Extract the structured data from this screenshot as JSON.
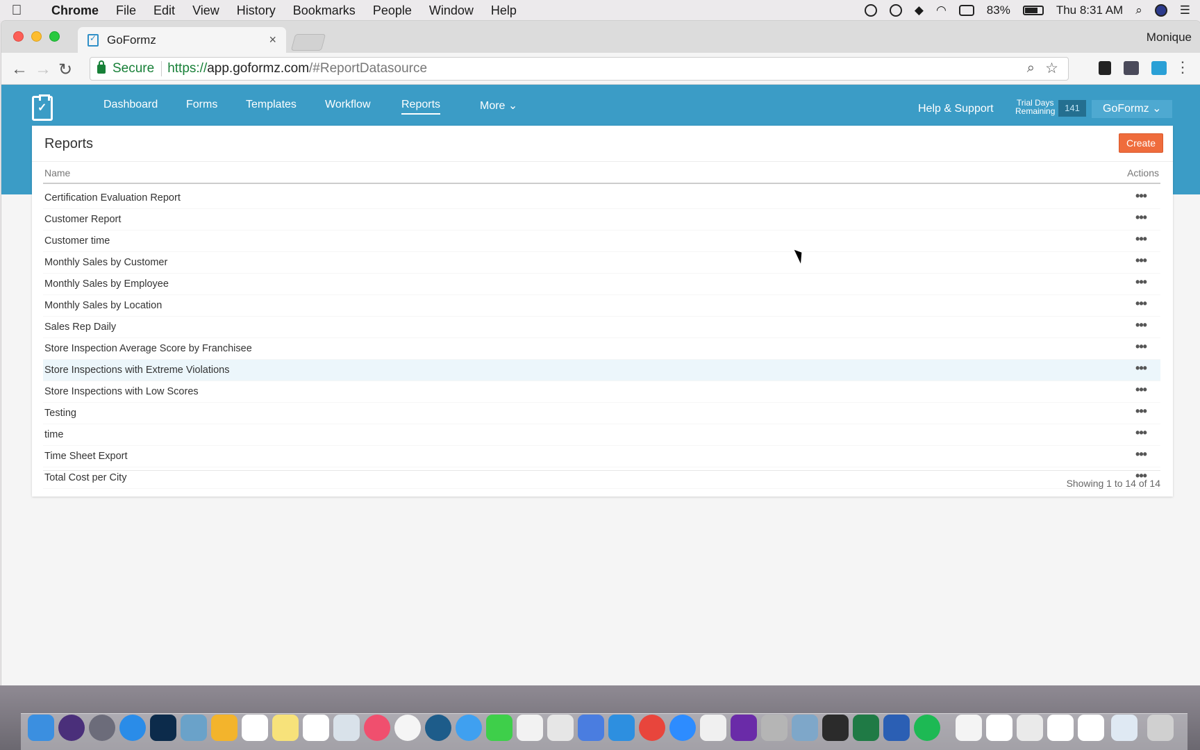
{
  "menubar": {
    "app": "Chrome",
    "items": [
      "File",
      "Edit",
      "View",
      "History",
      "Bookmarks",
      "People",
      "Window",
      "Help"
    ],
    "battery": "83%",
    "clock": "Thu 8:31 AM"
  },
  "browser": {
    "tab_title": "GoFormz",
    "profile": "Monique",
    "url": {
      "secure_label": "Secure",
      "scheme": "https://",
      "host": "app.goformz.com",
      "path": "/#ReportDatasource"
    }
  },
  "app": {
    "nav": [
      "Dashboard",
      "Forms",
      "Templates",
      "Workflow",
      "Reports",
      "More"
    ],
    "active_nav": "Reports",
    "help": "Help & Support",
    "trial_line1": "Trial Days",
    "trial_line2": "Remaining",
    "trial_count": "141",
    "org": "GoFormz"
  },
  "reports": {
    "title": "Reports",
    "create_label": "Create",
    "col_name": "Name",
    "col_actions": "Actions",
    "rows": [
      "Certification Evaluation Report",
      "Customer Report",
      "Customer time",
      "Monthly Sales by Customer",
      "Monthly Sales by Employee",
      "Monthly Sales by Location",
      "Sales Rep Daily",
      "Store Inspection Average Score by Franchisee",
      "Store Inspections with Extreme Violations",
      "Store Inspections with Low Scores",
      "Testing",
      "time",
      "Time Sheet Export",
      "Total Cost per City"
    ],
    "hovered_row": 8,
    "showing": "Showing 1 to 14 of 14"
  },
  "colors": {
    "header": "#3b9cc6",
    "create": "#ef6c3c",
    "hover": "#ecf6fb"
  }
}
